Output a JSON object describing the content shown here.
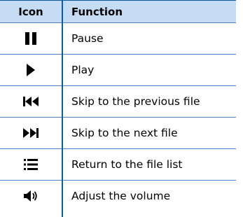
{
  "table": {
    "header": {
      "icon_col": "Icon",
      "function_col": "Function"
    },
    "rows": [
      {
        "icon": "pause-icon",
        "function": "Pause"
      },
      {
        "icon": "play-icon",
        "function": "Play"
      },
      {
        "icon": "skip-previous-icon",
        "function": "Skip to the previous file"
      },
      {
        "icon": "skip-next-icon",
        "function": "Skip to the next file"
      },
      {
        "icon": "file-list-icon",
        "function": "Return to the file list"
      },
      {
        "icon": "volume-icon",
        "function": "Adjust the volume"
      }
    ]
  },
  "colors": {
    "header_bg": "#c6dcf5",
    "rule": "#0b5aa8"
  }
}
